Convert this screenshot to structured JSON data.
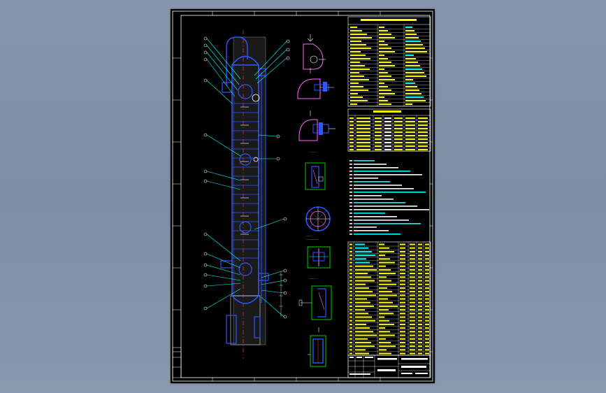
{
  "drawing": {
    "background": "#000000",
    "viewport_bg": "#8795aa",
    "colors": {
      "frame": "#ffffff",
      "vessel": "#3355ff",
      "centerline": "#ff3333",
      "leader": "#00ffff",
      "table_text": "#ffff00",
      "detail_outline": "#ff66ff",
      "detail_box": "#00ff00",
      "grid": "#aaaaaa"
    },
    "table_fill_pattern": "cad-text-rows",
    "icons": [
      "leader-balloon-icon",
      "section-arrow-icon"
    ]
  }
}
